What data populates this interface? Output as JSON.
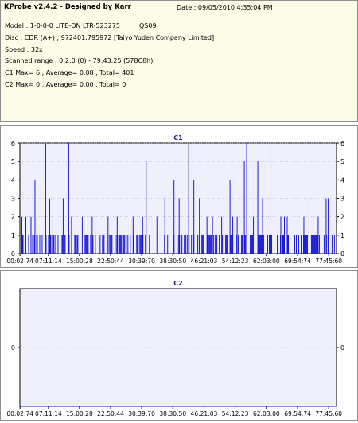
{
  "info": {
    "title": "KProbe v2.4.2 - Designed by Karr",
    "date": "Date : 09/05/2010 4:35:04 PM",
    "model": "Model : 1-0-0-0 LITE-ON LTR-523275",
    "model_code": "QS09",
    "disc": "Disc : CDR (A+) , 972401:795972 [Taiyo Yuden Company Limited]",
    "speed": "Speed : 32x",
    "range": "Scanned range : 0:2:0 (0) - 79:43:25 (578C8h)",
    "c1": "C1 Max= 6 , Average= 0.08 , Total= 401",
    "c2": "C2 Max= 0 , Average= 0.00 , Total= 0"
  },
  "colors": {
    "plot_bg": "#f0f0fd",
    "data": "#1a1ad4",
    "axis": "#000000",
    "title": "#1c1c8c",
    "grid": "#9aa7c8"
  },
  "chart_data": [
    {
      "type": "bar",
      "title": "C1",
      "ylim": [
        0,
        6
      ],
      "yticks": [
        0,
        1,
        2,
        3,
        4,
        5,
        6
      ],
      "xlim": [
        0,
        79.72
      ],
      "xtick_labels": [
        "00:02:74",
        "07:11:14",
        "15:00:28",
        "22:50:44",
        "30:39:70",
        "38:30:50",
        "46:21:03",
        "54:12:23",
        "62:03:00",
        "69:54:74",
        "77:45:60"
      ],
      "xtick_values": [
        0.04,
        7.19,
        15.0,
        22.84,
        30.66,
        38.51,
        46.35,
        54.2,
        62.05,
        69.92,
        77.76
      ],
      "grid": true,
      "spikes": [
        [
          0.5,
          2
        ],
        [
          1.5,
          2
        ],
        [
          2.8,
          2
        ],
        [
          3.8,
          4
        ],
        [
          4.3,
          2
        ],
        [
          6.5,
          6
        ],
        [
          7.5,
          3
        ],
        [
          8.3,
          2
        ],
        [
          10.9,
          3
        ],
        [
          12.3,
          6
        ],
        [
          13,
          2
        ],
        [
          15.7,
          2
        ],
        [
          18.2,
          2
        ],
        [
          22.2,
          2
        ],
        [
          24.5,
          2
        ],
        [
          28.5,
          2
        ],
        [
          30.9,
          2
        ],
        [
          31.8,
          5
        ],
        [
          34.5,
          2
        ],
        [
          36.5,
          3
        ],
        [
          38.8,
          4
        ],
        [
          40.1,
          3
        ],
        [
          42.5,
          6
        ],
        [
          43.8,
          4
        ],
        [
          45.2,
          3
        ],
        [
          47.1,
          2
        ],
        [
          48.5,
          2
        ],
        [
          50.8,
          2
        ],
        [
          52.9,
          4
        ],
        [
          53.6,
          2
        ],
        [
          54.7,
          2
        ],
        [
          56.5,
          5
        ],
        [
          57.1,
          6
        ],
        [
          58.8,
          2
        ],
        [
          59.9,
          5
        ],
        [
          61.1,
          3
        ],
        [
          62.2,
          2
        ],
        [
          63,
          6
        ],
        [
          65.7,
          2
        ],
        [
          66.6,
          2
        ],
        [
          67.3,
          2
        ],
        [
          71.5,
          2
        ],
        [
          72.8,
          3
        ],
        [
          75.1,
          2
        ],
        [
          77.1,
          3
        ],
        [
          77.6,
          3
        ]
      ],
      "ones_density": 0.4
    },
    {
      "type": "line",
      "title": "C2",
      "ylim": [
        0,
        1
      ],
      "yticks": [
        0
      ],
      "xlim": [
        0,
        79.72
      ],
      "xtick_labels": [
        "00:02:74",
        "07:11:14",
        "15:00:28",
        "22:50:44",
        "30:39:70",
        "38:30:50",
        "46:21:03",
        "54:12:23",
        "62:03:00",
        "69:54:74",
        "77:45:60"
      ],
      "xtick_values": [
        0.04,
        7.19,
        15.0,
        22.84,
        30.66,
        38.51,
        46.35,
        54.2,
        62.05,
        69.92,
        77.76
      ],
      "values": [
        0
      ]
    }
  ]
}
